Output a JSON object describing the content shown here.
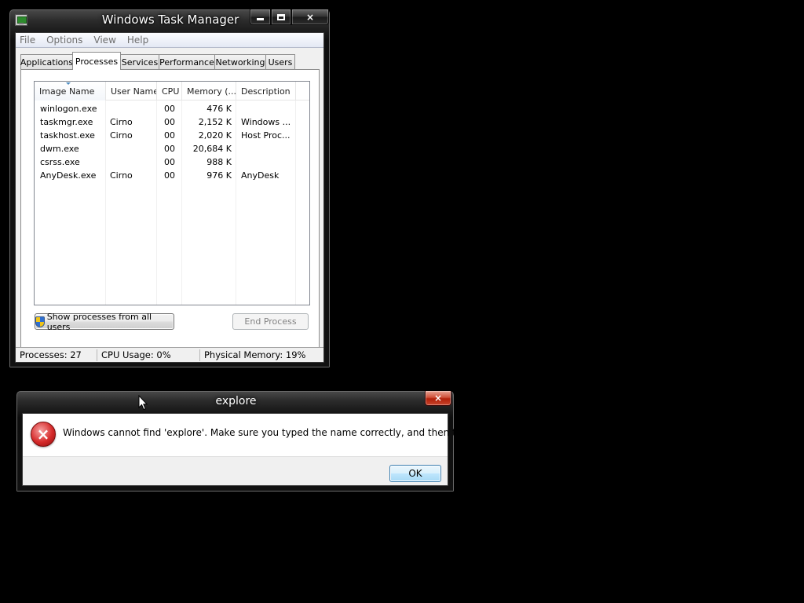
{
  "task_manager": {
    "title": "Windows Task Manager",
    "menu": [
      "File",
      "Options",
      "View",
      "Help"
    ],
    "tabs": [
      "Applications",
      "Processes",
      "Services",
      "Performance",
      "Networking",
      "Users"
    ],
    "active_tab": "Processes",
    "columns": [
      "Image Name",
      "User Name",
      "CPU",
      "Memory (...",
      "Description"
    ],
    "sorted_column": "Image Name",
    "processes": [
      {
        "image": "winlogon.exe",
        "user": "",
        "cpu": "00",
        "memory": "476 K",
        "description": ""
      },
      {
        "image": "taskmgr.exe",
        "user": "Cirno",
        "cpu": "00",
        "memory": "2,152 K",
        "description": "Windows ..."
      },
      {
        "image": "taskhost.exe",
        "user": "Cirno",
        "cpu": "00",
        "memory": "2,020 K",
        "description": "Host Proc..."
      },
      {
        "image": "dwm.exe",
        "user": "",
        "cpu": "00",
        "memory": "20,684 K",
        "description": ""
      },
      {
        "image": "csrss.exe",
        "user": "",
        "cpu": "00",
        "memory": "988 K",
        "description": ""
      },
      {
        "image": "AnyDesk.exe",
        "user": "Cirno",
        "cpu": "00",
        "memory": "976 K",
        "description": "AnyDesk"
      }
    ],
    "show_all_label": "Show processes from all users",
    "end_process_label": "End Process",
    "status": {
      "processes": "Processes: 27",
      "cpu": "CPU Usage: 0%",
      "memory": "Physical Memory: 19%"
    }
  },
  "error_dialog": {
    "title": "explore",
    "message": "Windows cannot find 'explore'. Make sure you typed the name correctly, and then try again.",
    "ok_label": "OK"
  },
  "icons": {
    "window_close": "×",
    "error": "×"
  },
  "colors": {
    "desktop": "#000000",
    "close_button": "#c8452c",
    "error_icon": "#d62b2b",
    "ok_button_border": "#3c7fb1"
  }
}
